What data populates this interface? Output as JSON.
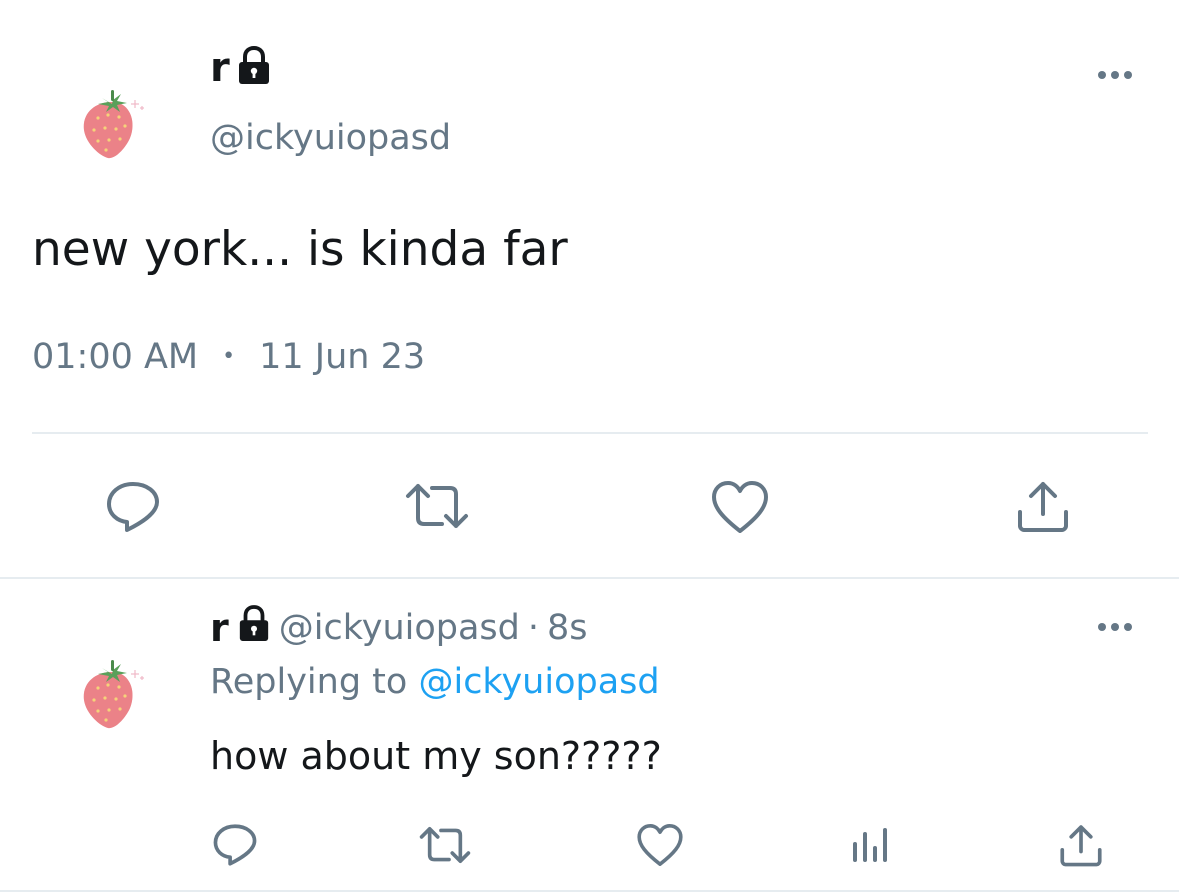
{
  "main_tweet": {
    "display_name": "r",
    "handle": "@ickyuiopasd",
    "text": "new york... is kinda far",
    "time": "01:00 AM",
    "separator": "•",
    "date": "11 Jun 23",
    "actions": [
      "reply-icon",
      "retweet-icon",
      "like-icon",
      "share-icon"
    ]
  },
  "reply_tweet": {
    "display_name": "r",
    "handle": "@ickyuiopasd",
    "meta_separator": "·",
    "age": "8s",
    "replying_prefix": "Replying to",
    "replying_handle": "@ickyuiopasd",
    "text": "how about my son?????",
    "actions": [
      "reply-icon",
      "retweet-icon",
      "like-icon",
      "analytics-icon",
      "share-icon"
    ]
  },
  "colors": {
    "text": "#14171a",
    "muted": "#657786",
    "link": "#1da1f2",
    "divider": "#e6ecf0",
    "strawberry": "#e8757b",
    "leaf": "#5aa05a"
  }
}
